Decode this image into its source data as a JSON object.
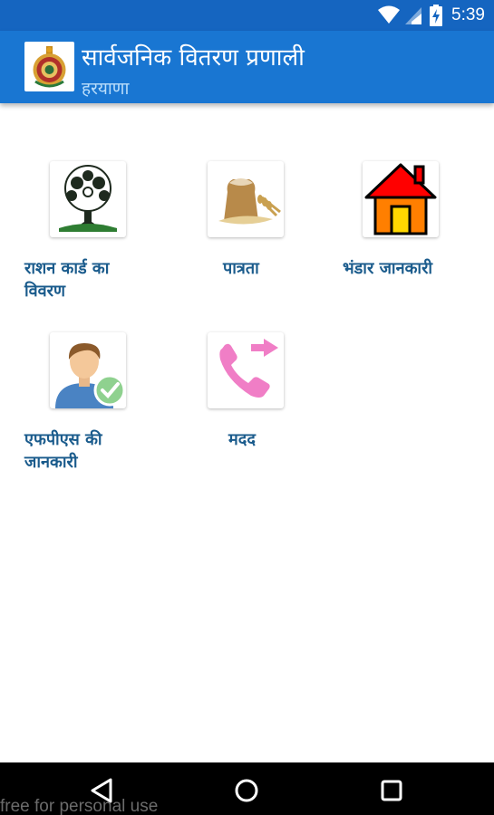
{
  "status_bar": {
    "time": "5:39",
    "icons": [
      "wifi-icon",
      "cell-signal-icon",
      "battery-charging-icon"
    ]
  },
  "app_bar": {
    "title": "सार्वजनिक वितरण प्रणाली",
    "subtitle": "हरयाणा",
    "logo": "haryana-emblem-icon",
    "color": "#1976d2",
    "status_color": "#1565c0"
  },
  "menu": {
    "items": [
      {
        "label": "राशन कार्ड का विवरण",
        "icon": "ration-card-tree-icon"
      },
      {
        "label": "पात्रता",
        "icon": "grain-sack-icon"
      },
      {
        "label": "भंडार जानकारी",
        "icon": "house-icon"
      },
      {
        "label": "एफपीएस की जानकारी",
        "icon": "user-check-icon"
      },
      {
        "label": "मदद",
        "icon": "phone-forward-icon"
      }
    ],
    "label_color": "#1a5b8c"
  },
  "nav_bar": {
    "buttons": [
      "back-icon",
      "home-icon",
      "recents-icon"
    ]
  },
  "watermark": "free for personal use"
}
